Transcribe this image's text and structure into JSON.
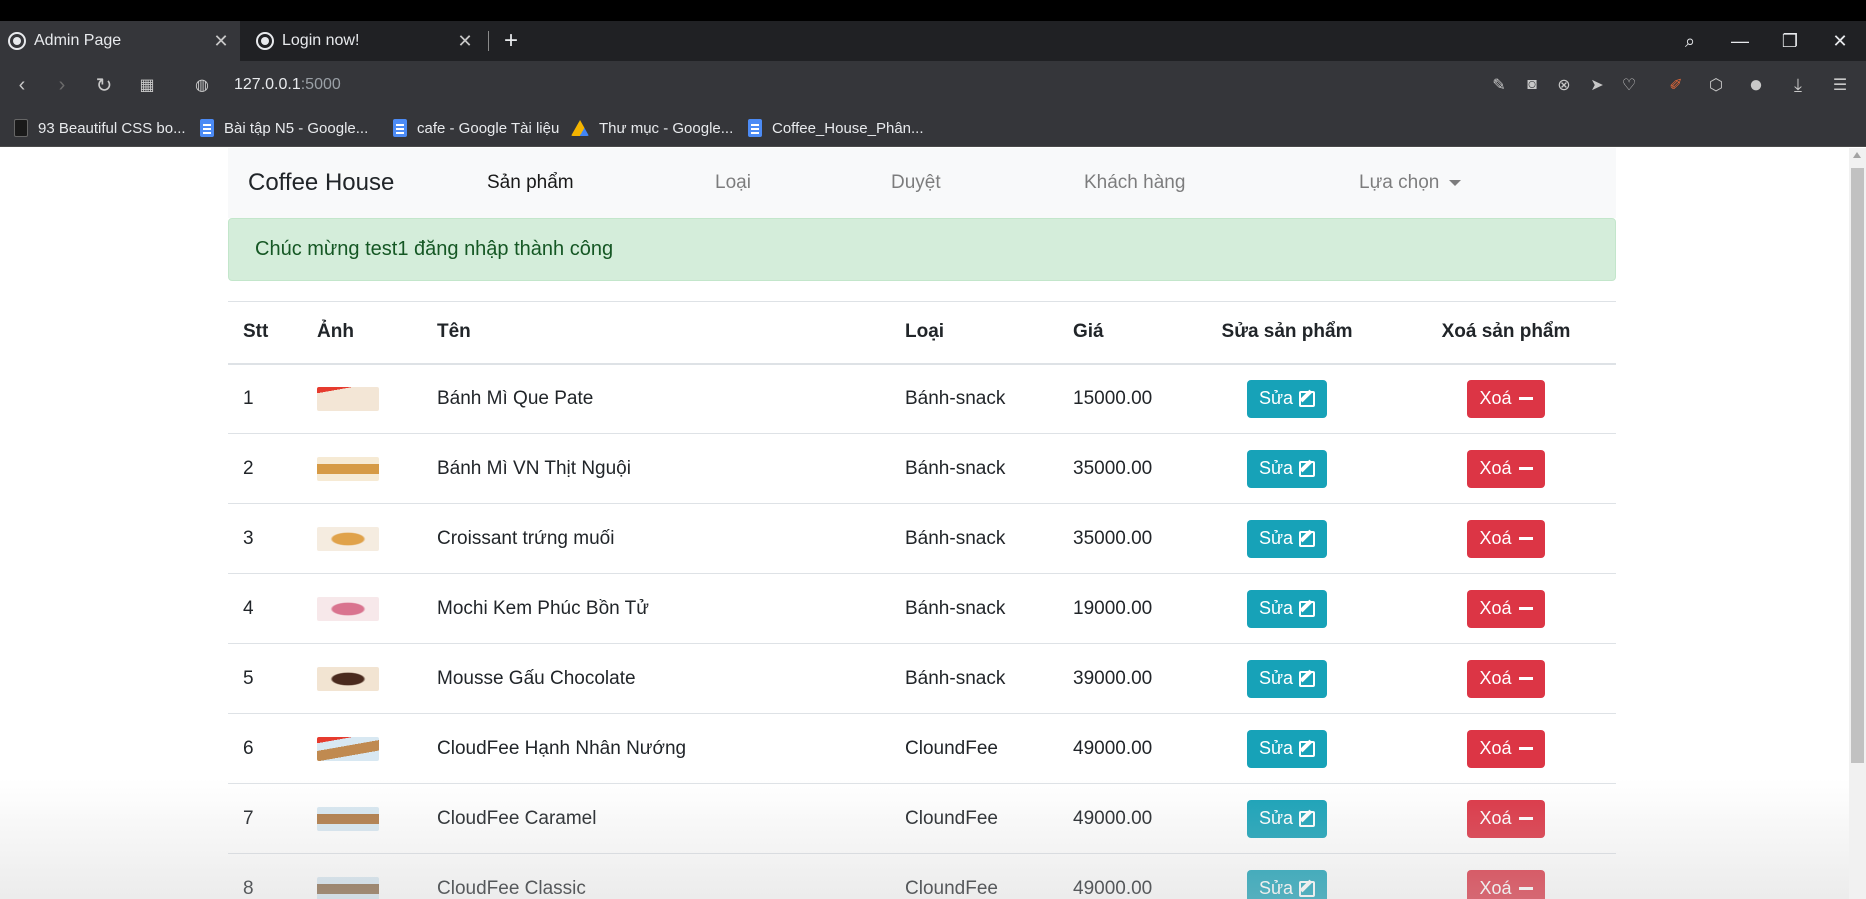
{
  "browser": {
    "tabs": [
      {
        "title": "Admin Page",
        "active": true
      },
      {
        "title": "Login now!",
        "active": false
      }
    ],
    "url_host": "127.0.0.1",
    "url_port": ":5000",
    "bookmarks": [
      {
        "label": "93 Beautiful CSS bo...",
        "icon": "css-icon"
      },
      {
        "label": "Bài tập N5 - Google...",
        "icon": "google-docs-icon"
      },
      {
        "label": "cafe - Google Tài liệu",
        "icon": "google-docs-icon"
      },
      {
        "label": "Thư mục - Google...",
        "icon": "google-drive-icon"
      },
      {
        "label": "Coffee_House_Phân...",
        "icon": "google-docs-icon"
      }
    ]
  },
  "navbar": {
    "brand": "Coffee House",
    "links": [
      "Sản phẩm",
      "Loại",
      "Duyệt",
      "Khách hàng"
    ],
    "dropdown": "Lựa chọn"
  },
  "alert": {
    "message": "Chúc mừng test1 đăng nhập thành công",
    "color": "#d4edda"
  },
  "table": {
    "headers": [
      "Stt",
      "Ảnh",
      "Tên",
      "Loại",
      "Giá",
      "Sửa sản phẩm",
      "Xoá sản phẩm"
    ],
    "edit_label": "Sửa",
    "delete_label": "Xoá",
    "rows": [
      {
        "stt": "1",
        "name": "Bánh Mì Que Pate",
        "category": "Bánh-snack",
        "price": "15000.00"
      },
      {
        "stt": "2",
        "name": "Bánh Mì VN Thịt Nguội",
        "category": "Bánh-snack",
        "price": "35000.00"
      },
      {
        "stt": "3",
        "name": "Croissant trứng muối",
        "category": "Bánh-snack",
        "price": "35000.00"
      },
      {
        "stt": "4",
        "name": "Mochi Kem Phúc Bồn Tử",
        "category": "Bánh-snack",
        "price": "19000.00"
      },
      {
        "stt": "5",
        "name": "Mousse Gấu Chocolate",
        "category": "Bánh-snack",
        "price": "39000.00"
      },
      {
        "stt": "6",
        "name": "CloudFee Hạnh Nhân Nướng",
        "category": "CloundFee",
        "price": "49000.00"
      },
      {
        "stt": "7",
        "name": "CloudFee Caramel",
        "category": "CloundFee",
        "price": "49000.00"
      },
      {
        "stt": "8",
        "name": "CloudFee Classic",
        "category": "CloundFee",
        "price": "49000.00"
      }
    ]
  },
  "colors": {
    "edit_button": "#17a2b8",
    "delete_button": "#dc3545",
    "navbar_bg": "#f8f9fa"
  }
}
